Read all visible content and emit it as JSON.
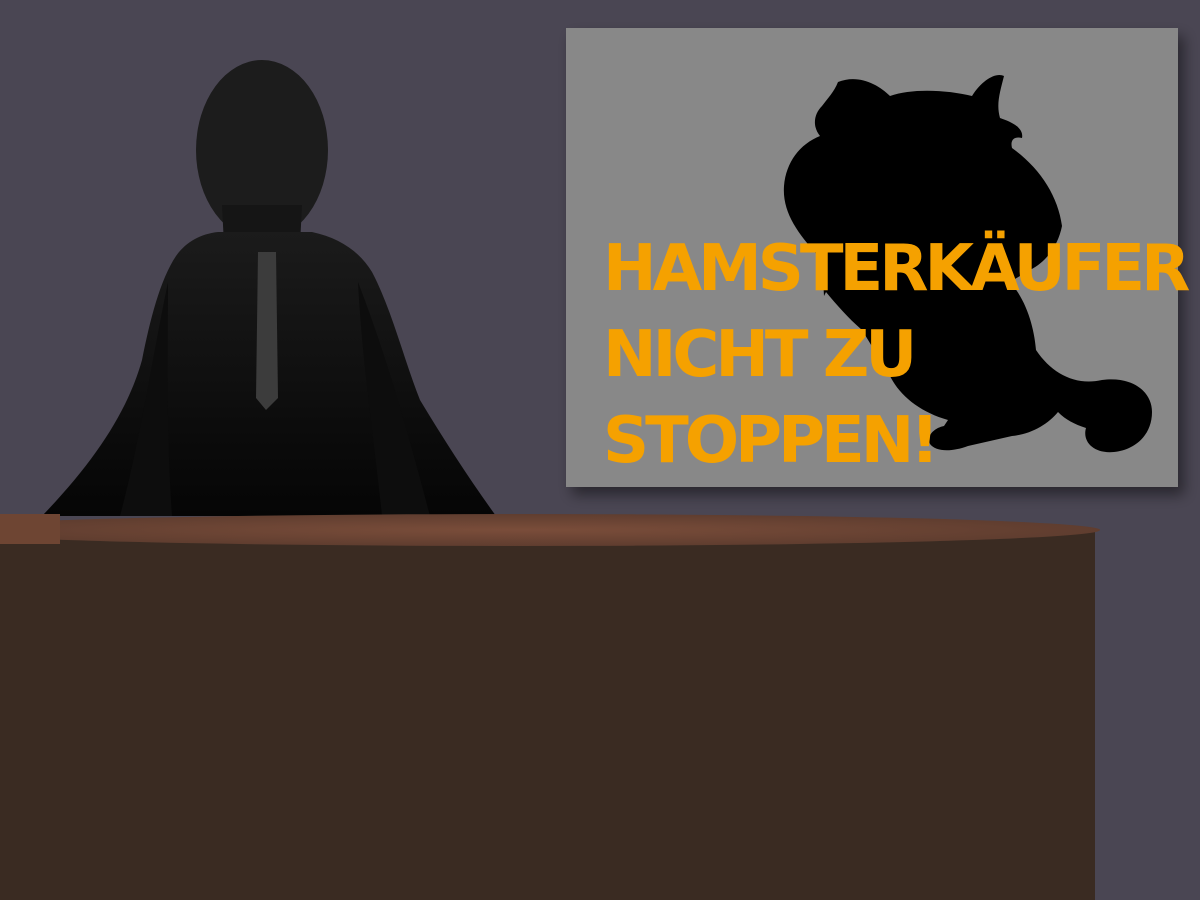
{
  "screen": {
    "headline_lines": [
      "HAMSTERKÄUFER",
      "NICHT ZU",
      "STOPPEN!"
    ]
  },
  "colors": {
    "wall": "#4a4653",
    "screen_panel": "#888888",
    "headline_text": "#f5a100",
    "hamster_silhouette": "#000000",
    "anchor_silhouette": "#111111",
    "tie": "#3c3c3c",
    "desk_top": "#7a4d3a",
    "desk_front": "#3a2b22"
  },
  "icons": {
    "presenter": "news-anchor-silhouette",
    "hamster": "hamster-silhouette"
  }
}
